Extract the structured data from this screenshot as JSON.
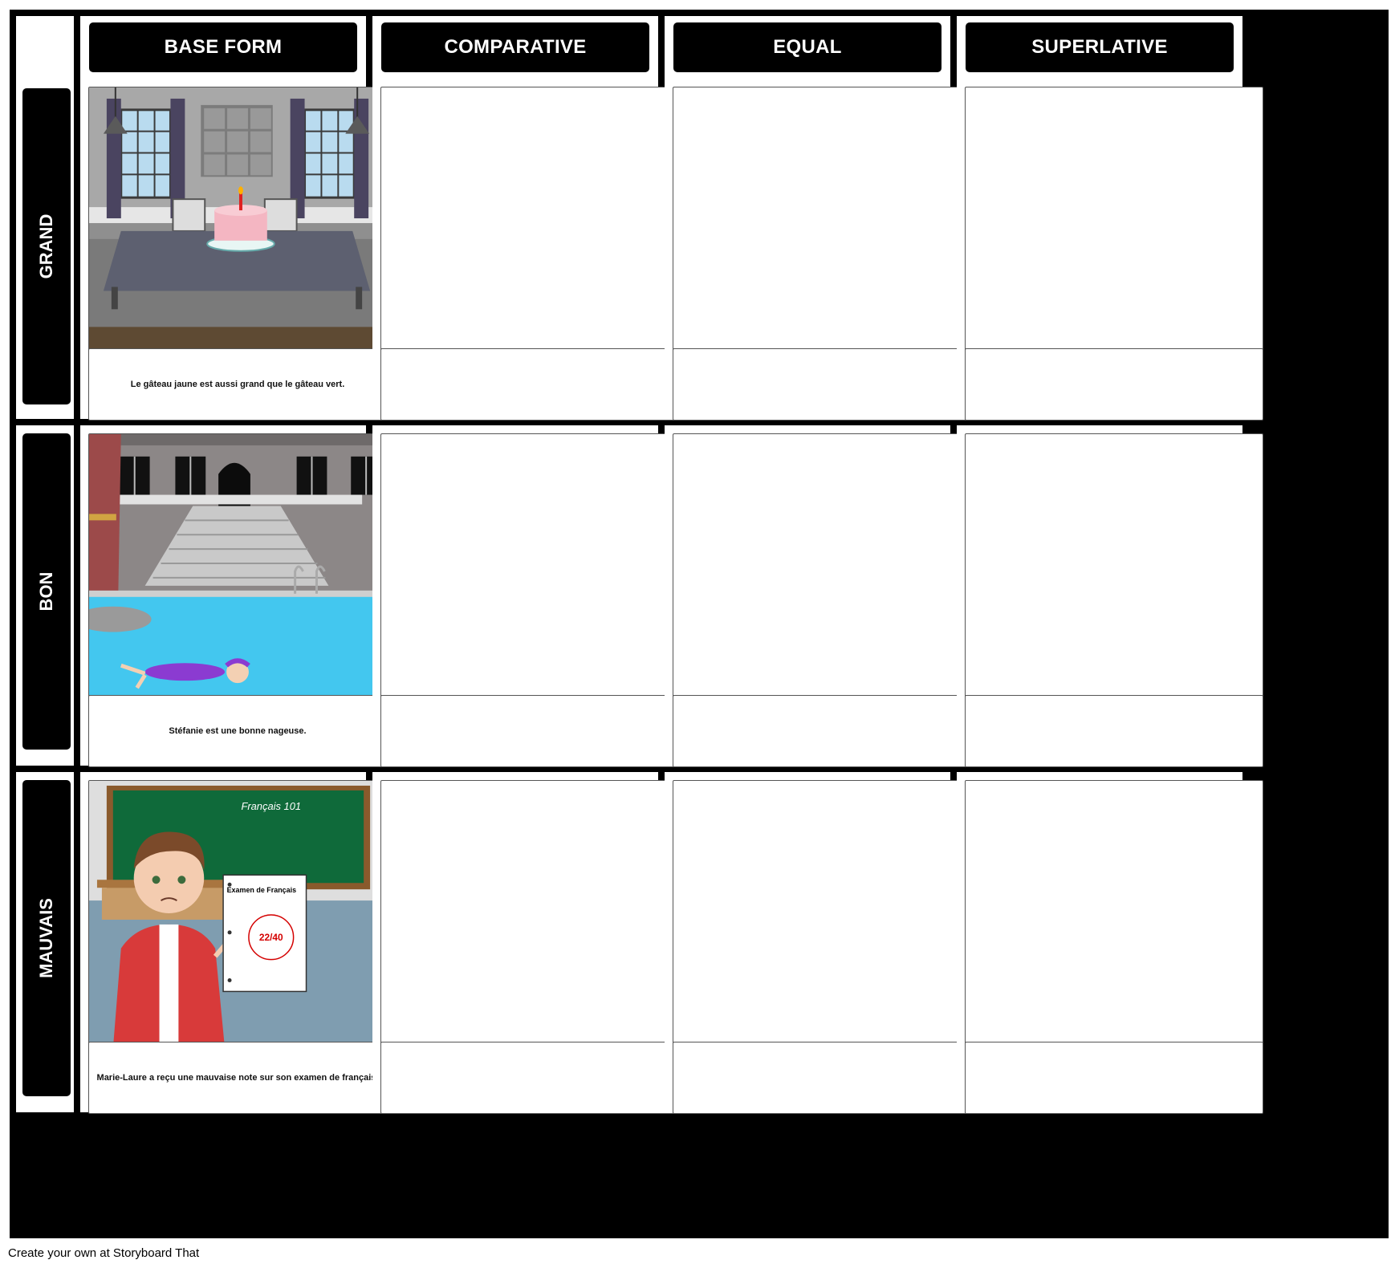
{
  "columns": [
    "BASE FORM",
    "COMPARATIVE",
    "EQUAL",
    "SUPERLATIVE"
  ],
  "rows": [
    {
      "label": "GRAND",
      "base_caption": "Le gâteau jaune est aussi grand que le gâteau vert.",
      "scene": "dining-room-cake-icon"
    },
    {
      "label": "BON",
      "base_caption": "Stéfanie est une bonne nageuse.",
      "scene": "swimming-pool-icon"
    },
    {
      "label": "MAUVAIS",
      "base_caption": "Marie-Laure a reçu une mauvaise note sur son examen de français.",
      "scene": "classroom-exam-icon",
      "blackboard_text": "Français 101",
      "exam_title": "Examen de Français",
      "exam_score": "22/40"
    }
  ],
  "footer": "Create your own at Storyboard That",
  "colors": {
    "background": "#000000",
    "cell": "#ffffff",
    "score": "#d40000"
  }
}
